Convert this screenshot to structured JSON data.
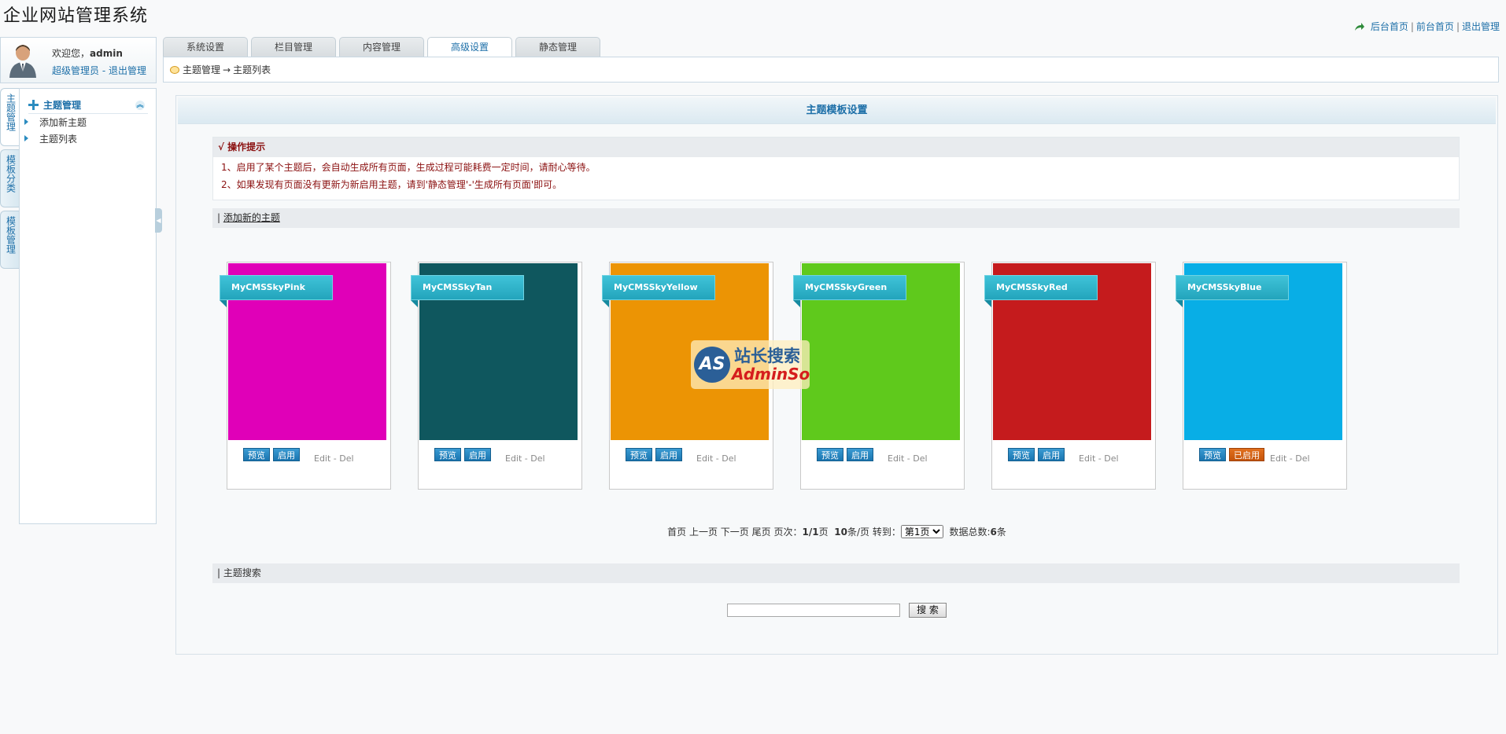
{
  "app": {
    "title": "企业网站管理系统"
  },
  "top_links": {
    "backend_home": "后台首页",
    "frontend_home": "前台首页",
    "logout": "退出管理",
    "separator": "|",
    "icon": "arrow-icon"
  },
  "user": {
    "welcome_prefix": "欢迎您，",
    "username": "admin",
    "role": "超级管理员",
    "dash": " - ",
    "logout": "退出管理"
  },
  "vertical_tabs": [
    {
      "label": "主题管理"
    },
    {
      "label": "模板分类"
    },
    {
      "label": "模板管理"
    }
  ],
  "sidebar": {
    "header": "主题管理",
    "items": [
      {
        "label": "添加新主题"
      },
      {
        "label": "主题列表"
      }
    ]
  },
  "tabs": [
    {
      "label": "系统设置"
    },
    {
      "label": "栏目管理"
    },
    {
      "label": "内容管理"
    },
    {
      "label": "高级设置"
    },
    {
      "label": "静态管理"
    }
  ],
  "active_tab": "高级设置",
  "breadcrumb": {
    "parent": "主题管理",
    "arrow": "→",
    "current": "主题列表"
  },
  "panel": {
    "title": "主题模板设置"
  },
  "tips": {
    "head": "√ 操作提示",
    "lines": [
      "1、启用了某个主题后，会自动生成所有页面，生成过程可能耗费一定时间，请耐心等待。",
      "2、如果发现有页面没有更新为新启用主题，请到'静态管理'-'生成所有页面'即可。"
    ]
  },
  "add_bar": {
    "prefix": "| ",
    "link": "添加新的主题"
  },
  "themes": [
    {
      "name": "MyCMSSkyPink",
      "color": "#e000b8",
      "preview": "预览",
      "action": "启用",
      "edit": "Edit",
      "del": "Del",
      "enabled": false
    },
    {
      "name": "MyCMSSkyTan",
      "color": "#0f575e",
      "preview": "预览",
      "action": "启用",
      "edit": "Edit",
      "del": "Del",
      "enabled": false
    },
    {
      "name": "MyCMSSkyYellow",
      "color": "#ec9404",
      "preview": "预览",
      "action": "启用",
      "edit": "Edit",
      "del": "Del",
      "enabled": false
    },
    {
      "name": "MyCMSSkyGreen",
      "color": "#5fc91c",
      "preview": "预览",
      "action": "启用",
      "edit": "Edit",
      "del": "Del",
      "enabled": false
    },
    {
      "name": "MyCMSSkyRed",
      "color": "#c51b1d",
      "preview": "预览",
      "action": "启用",
      "edit": "Edit",
      "del": "Del",
      "enabled": false
    },
    {
      "name": "MyCMSSkyBlue",
      "color": "#08aee6",
      "preview": "预览",
      "action": "已启用",
      "edit": "Edit",
      "del": "Del",
      "enabled": true
    }
  ],
  "pager": {
    "first": "首页",
    "prev": "上一页",
    "next": "下一页",
    "last": "尾页",
    "page_label": "页次：",
    "page_value": "1/1",
    "page_suffix": "页",
    "per_page_value": "10",
    "per_page_suffix": "条/页",
    "goto": "转到：",
    "goto_option": "第1页",
    "total_label": "数据总数:",
    "total_value": "6",
    "total_suffix": "条"
  },
  "search": {
    "bar_label": "| 主题搜索",
    "input_value": "",
    "button": "搜 索"
  },
  "watermark": {
    "badge": "AS",
    "cn": "站长搜索",
    "en": "AdminSo"
  }
}
